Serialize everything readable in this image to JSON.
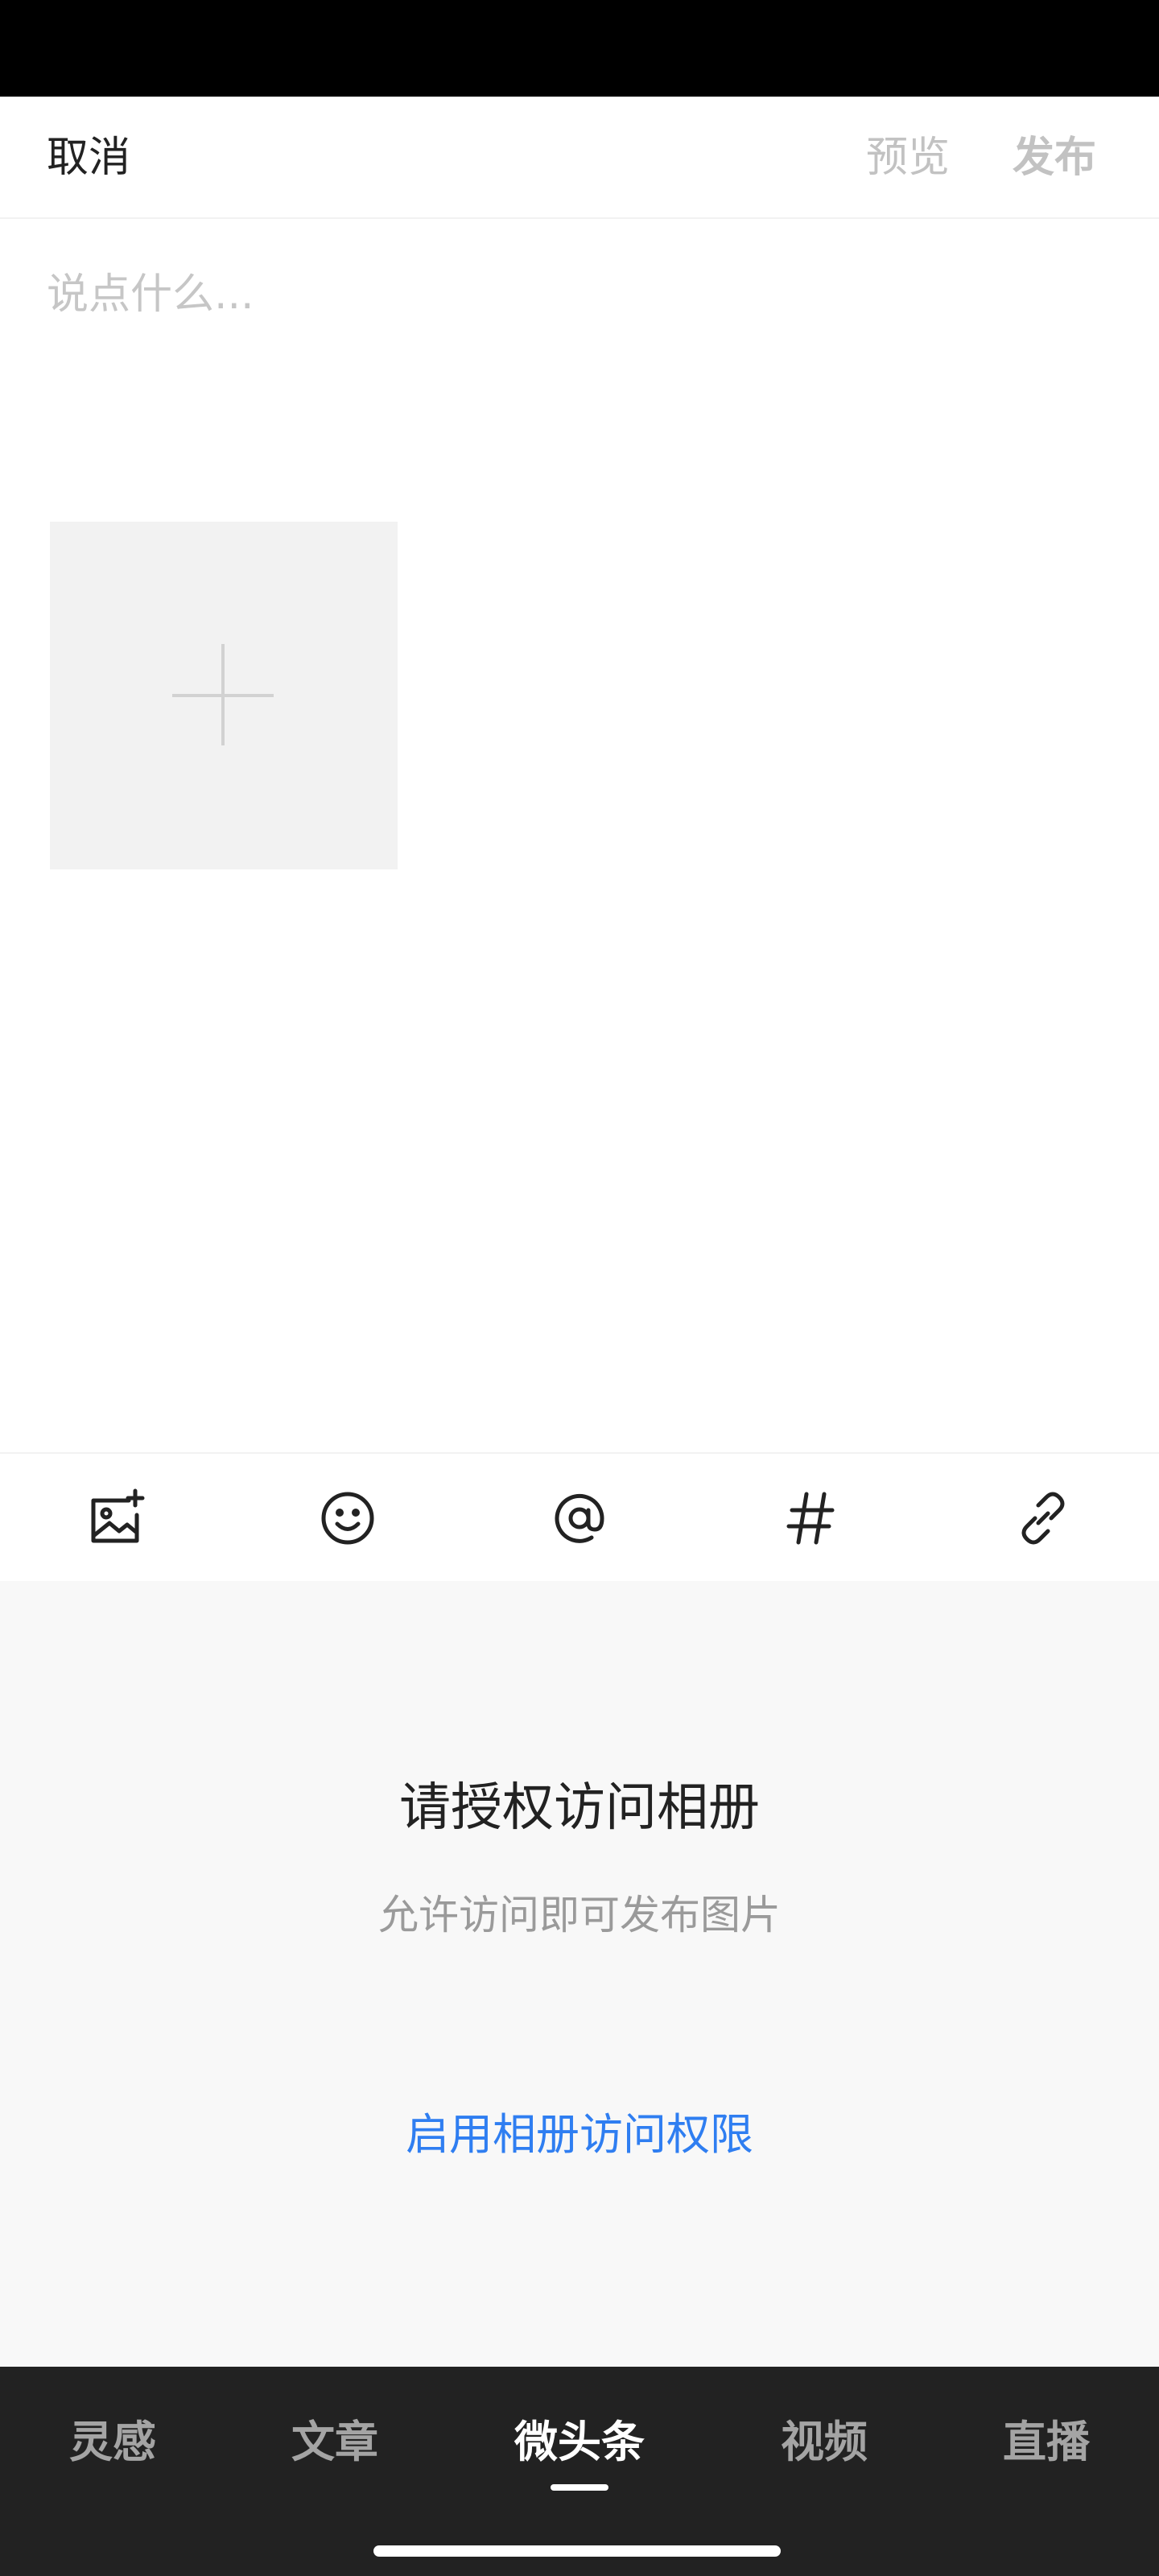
{
  "header": {
    "cancel_label": "取消",
    "preview_label": "预览",
    "publish_label": "发布"
  },
  "composer": {
    "placeholder": "说点什么..."
  },
  "toolbar": {
    "icons": [
      "image-add-icon",
      "emoji-icon",
      "mention-icon",
      "hashtag-icon",
      "link-icon"
    ]
  },
  "permission": {
    "title": "请授权访问相册",
    "subtitle": "允许访问即可发布图片",
    "action": "启用相册访问权限"
  },
  "bottom_nav": {
    "items": [
      {
        "label": "灵感"
      },
      {
        "label": "文章"
      },
      {
        "label": "微头条"
      },
      {
        "label": "视频"
      },
      {
        "label": "直播"
      }
    ],
    "active_index": 2
  },
  "colors": {
    "accent": "#2f7ef1",
    "nav_bg": "#222222",
    "panel_bg": "#f8f8f8"
  }
}
